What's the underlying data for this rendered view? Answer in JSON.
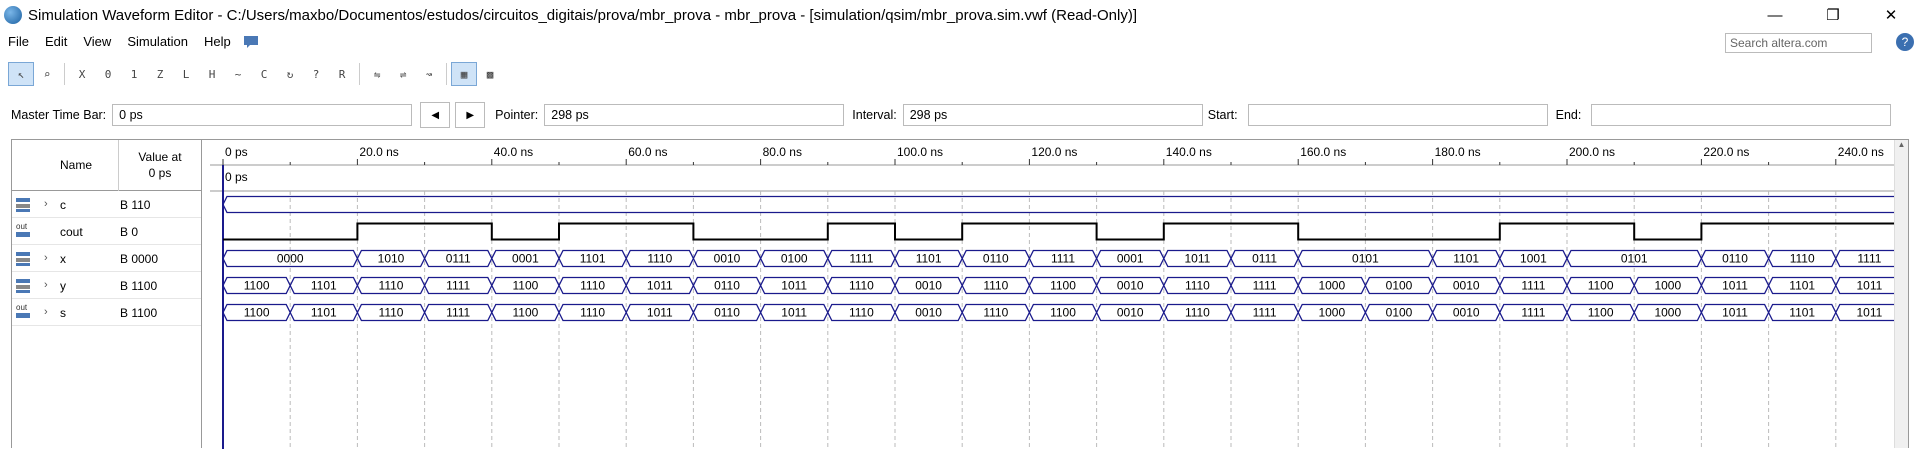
{
  "window": {
    "title": "Simulation Waveform Editor - C:/Users/maxbo/Documentos/estudos/circuitos_digitais/prova/mbr_prova - mbr_prova - [simulation/qsim/mbr_prova.sim.vwf (Read-Only)]"
  },
  "menu": [
    "File",
    "Edit",
    "View",
    "Simulation",
    "Help"
  ],
  "search": {
    "placeholder": "Search altera.com"
  },
  "timebar": {
    "master_label": "Master Time Bar:",
    "master_value": "0 ps",
    "pointer_label": "Pointer:",
    "pointer_value": "298 ps",
    "interval_label": "Interval:",
    "interval_value": "298 ps",
    "start_label": "Start:",
    "start_value": "",
    "end_label": "End:",
    "end_value": ""
  },
  "columns": {
    "name": "Name",
    "value_line1": "Value at",
    "value_line2": "0 ps"
  },
  "ruler": {
    "labels": [
      "0 ps",
      "20.0 ns",
      "40.0 ns",
      "60.0 ns",
      "80.0 ns",
      "100.0 ns",
      "120.0 ns",
      "140.0 ns",
      "160.0 ns",
      "180.0 ns",
      "200.0 ns",
      "220.0 ns",
      "240.0 ns"
    ],
    "cursor_label": "0 ps"
  },
  "signals": [
    {
      "name": "c",
      "value": "B 110",
      "icon": "input-bus-icon",
      "expandable": true,
      "type": "bus",
      "segments": [
        {
          "t0": 0,
          "t1": 250,
          "v": ""
        }
      ]
    },
    {
      "name": "cout",
      "value": "B 0",
      "icon": "output-pin-icon",
      "expandable": false,
      "type": "bit",
      "levels": [
        0,
        0,
        1,
        1,
        0,
        1,
        1,
        0,
        0,
        1,
        0,
        1,
        1,
        0,
        1,
        1,
        0,
        0,
        0,
        1,
        1,
        0,
        1,
        1,
        1
      ]
    },
    {
      "name": "x",
      "value": "B 0000",
      "icon": "input-bus-icon",
      "expandable": true,
      "type": "bus",
      "segments": [
        {
          "t0": 0,
          "t1": 20,
          "v": "0000"
        },
        {
          "t0": 20,
          "t1": 30,
          "v": "1010"
        },
        {
          "t0": 30,
          "t1": 40,
          "v": "0111"
        },
        {
          "t0": 40,
          "t1": 50,
          "v": "0001"
        },
        {
          "t0": 50,
          "t1": 60,
          "v": "1101"
        },
        {
          "t0": 60,
          "t1": 70,
          "v": "1110"
        },
        {
          "t0": 70,
          "t1": 80,
          "v": "0010"
        },
        {
          "t0": 80,
          "t1": 90,
          "v": "0100"
        },
        {
          "t0": 90,
          "t1": 100,
          "v": "1111"
        },
        {
          "t0": 100,
          "t1": 110,
          "v": "1101"
        },
        {
          "t0": 110,
          "t1": 120,
          "v": "0110"
        },
        {
          "t0": 120,
          "t1": 130,
          "v": "1111"
        },
        {
          "t0": 130,
          "t1": 140,
          "v": "0001"
        },
        {
          "t0": 140,
          "t1": 150,
          "v": "1011"
        },
        {
          "t0": 150,
          "t1": 160,
          "v": "0111"
        },
        {
          "t0": 160,
          "t1": 180,
          "v": "0101"
        },
        {
          "t0": 180,
          "t1": 190,
          "v": "1101"
        },
        {
          "t0": 190,
          "t1": 200,
          "v": "1001"
        },
        {
          "t0": 200,
          "t1": 220,
          "v": "0101"
        },
        {
          "t0": 220,
          "t1": 230,
          "v": "0110"
        },
        {
          "t0": 230,
          "t1": 240,
          "v": "1110"
        },
        {
          "t0": 240,
          "t1": 250,
          "v": "1111"
        }
      ]
    },
    {
      "name": "y",
      "value": "B 1100",
      "icon": "input-bus-icon",
      "expandable": true,
      "type": "bus",
      "segments": [
        {
          "t0": 0,
          "t1": 10,
          "v": "1100"
        },
        {
          "t0": 10,
          "t1": 20,
          "v": "1101"
        },
        {
          "t0": 20,
          "t1": 30,
          "v": "1110"
        },
        {
          "t0": 30,
          "t1": 40,
          "v": "1111"
        },
        {
          "t0": 40,
          "t1": 50,
          "v": "1100"
        },
        {
          "t0": 50,
          "t1": 60,
          "v": "1110"
        },
        {
          "t0": 60,
          "t1": 70,
          "v": "1011"
        },
        {
          "t0": 70,
          "t1": 80,
          "v": "0110"
        },
        {
          "t0": 80,
          "t1": 90,
          "v": "1011"
        },
        {
          "t0": 90,
          "t1": 100,
          "v": "1110"
        },
        {
          "t0": 100,
          "t1": 110,
          "v": "0010"
        },
        {
          "t0": 110,
          "t1": 120,
          "v": "1110"
        },
        {
          "t0": 120,
          "t1": 130,
          "v": "1100"
        },
        {
          "t0": 130,
          "t1": 140,
          "v": "0010"
        },
        {
          "t0": 140,
          "t1": 150,
          "v": "1110"
        },
        {
          "t0": 150,
          "t1": 160,
          "v": "1111"
        },
        {
          "t0": 160,
          "t1": 170,
          "v": "1000"
        },
        {
          "t0": 170,
          "t1": 180,
          "v": "0100"
        },
        {
          "t0": 180,
          "t1": 190,
          "v": "0010"
        },
        {
          "t0": 190,
          "t1": 200,
          "v": "1111"
        },
        {
          "t0": 200,
          "t1": 210,
          "v": "1100"
        },
        {
          "t0": 210,
          "t1": 220,
          "v": "1000"
        },
        {
          "t0": 220,
          "t1": 230,
          "v": "1011"
        },
        {
          "t0": 230,
          "t1": 240,
          "v": "1101"
        },
        {
          "t0": 240,
          "t1": 250,
          "v": "1011"
        }
      ]
    },
    {
      "name": "s",
      "value": "B 1100",
      "icon": "output-bus-icon",
      "expandable": true,
      "type": "bus",
      "segments": [
        {
          "t0": 0,
          "t1": 10,
          "v": "1100"
        },
        {
          "t0": 10,
          "t1": 20,
          "v": "1101"
        },
        {
          "t0": 20,
          "t1": 30,
          "v": "1110"
        },
        {
          "t0": 30,
          "t1": 40,
          "v": "1111"
        },
        {
          "t0": 40,
          "t1": 50,
          "v": "1100"
        },
        {
          "t0": 50,
          "t1": 60,
          "v": "1110"
        },
        {
          "t0": 60,
          "t1": 70,
          "v": "1011"
        },
        {
          "t0": 70,
          "t1": 80,
          "v": "0110"
        },
        {
          "t0": 80,
          "t1": 90,
          "v": "1011"
        },
        {
          "t0": 90,
          "t1": 100,
          "v": "1110"
        },
        {
          "t0": 100,
          "t1": 110,
          "v": "0010"
        },
        {
          "t0": 110,
          "t1": 120,
          "v": "1110"
        },
        {
          "t0": 120,
          "t1": 130,
          "v": "1100"
        },
        {
          "t0": 130,
          "t1": 140,
          "v": "0010"
        },
        {
          "t0": 140,
          "t1": 150,
          "v": "1110"
        },
        {
          "t0": 150,
          "t1": 160,
          "v": "1111"
        },
        {
          "t0": 160,
          "t1": 170,
          "v": "1000"
        },
        {
          "t0": 170,
          "t1": 180,
          "v": "0100"
        },
        {
          "t0": 180,
          "t1": 190,
          "v": "0010"
        },
        {
          "t0": 190,
          "t1": 200,
          "v": "1111"
        },
        {
          "t0": 200,
          "t1": 210,
          "v": "1100"
        },
        {
          "t0": 210,
          "t1": 220,
          "v": "1000"
        },
        {
          "t0": 220,
          "t1": 230,
          "v": "1011"
        },
        {
          "t0": 230,
          "t1": 240,
          "v": "1101"
        },
        {
          "t0": 240,
          "t1": 250,
          "v": "1011"
        }
      ]
    }
  ],
  "colors": {
    "wave": "#1a1a8c",
    "cursor": "#1a1a8c",
    "grid": "#bbbbbb"
  }
}
